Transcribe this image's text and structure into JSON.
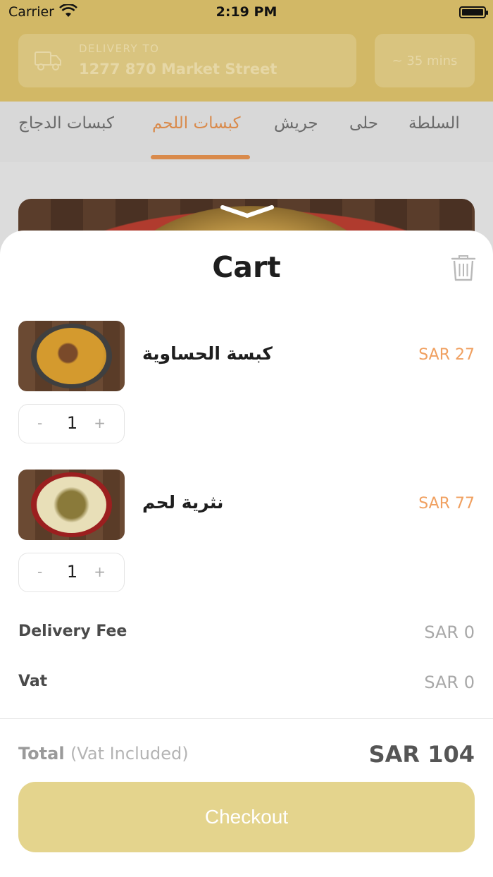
{
  "status_bar": {
    "carrier": "Carrier",
    "time": "2:19 PM"
  },
  "header": {
    "delivery_label": "DELIVERY TO",
    "delivery_address": "1277 870 Market Street",
    "eta": "~ 35 mins"
  },
  "categories": [
    {
      "label": "كبسات الدجاج",
      "active": false
    },
    {
      "label": "كبسات اللحم",
      "active": true
    },
    {
      "label": "جريش",
      "active": false
    },
    {
      "label": "حلى",
      "active": false
    },
    {
      "label": "السلطة",
      "active": false
    }
  ],
  "cart": {
    "title": "Cart",
    "items": [
      {
        "name": "كبسة الحساوية",
        "price": "SAR 27",
        "quantity": "1",
        "minus": "-",
        "plus": "+"
      },
      {
        "name": "نثرية لحم",
        "price": "SAR 77",
        "quantity": "1",
        "minus": "-",
        "plus": "+"
      }
    ],
    "fees": [
      {
        "label": "Delivery Fee",
        "value": "SAR 0"
      },
      {
        "label": "Vat",
        "value": "SAR 0"
      }
    ],
    "total_label": "Total",
    "total_sublabel": "(Vat Included)",
    "total_value": "SAR 104",
    "checkout_label": "Checkout"
  },
  "colors": {
    "header_bg": "#d2b866",
    "accent_orange": "#d98a4b",
    "price_orange": "#f0a060",
    "checkout_bg": "#e4d48d"
  },
  "icons": [
    "wifi-icon",
    "battery-icon",
    "truck-icon",
    "chevron-down-icon",
    "trash-icon"
  ]
}
